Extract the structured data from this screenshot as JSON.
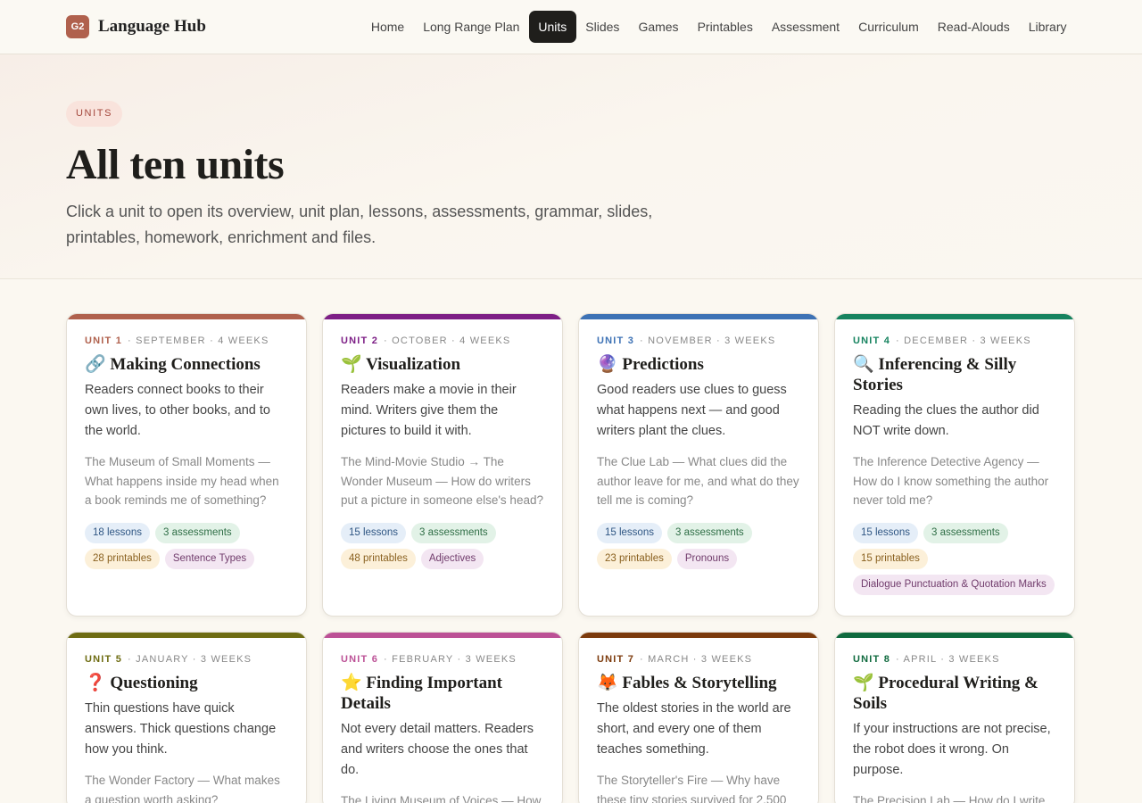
{
  "brand": {
    "logo_text": "G2",
    "name": "Language Hub"
  },
  "nav": [
    {
      "label": "Home",
      "active": false
    },
    {
      "label": "Long Range Plan",
      "active": false
    },
    {
      "label": "Units",
      "active": true
    },
    {
      "label": "Slides",
      "active": false
    },
    {
      "label": "Games",
      "active": false
    },
    {
      "label": "Printables",
      "active": false
    },
    {
      "label": "Assessment",
      "active": false
    },
    {
      "label": "Curriculum",
      "active": false
    },
    {
      "label": "Read-Alouds",
      "active": false
    },
    {
      "label": "Library",
      "active": false
    }
  ],
  "hero": {
    "kicker": "UNITS",
    "title": "All ten units",
    "subtitle": "Click a unit to open its overview, unit plan, lessons, assessments, grammar, slides, printables, homework, enrichment and files."
  },
  "units": [
    {
      "unit": "UNIT 1",
      "meta": "· SEPTEMBER · 4 WEEKS",
      "color": "#b0614d",
      "emoji": "🔗",
      "title": "Making Connections",
      "desc": "Readers connect books to their own lives, to other books, and to the world.",
      "quest": "The Museum of Small Moments — What happens inside my head when a book reminds me of something?",
      "lessons": "18 lessons",
      "assessments": "3 assessments",
      "printables": "28 printables",
      "grammar": "Sentence Types"
    },
    {
      "unit": "UNIT 2",
      "meta": "· OCTOBER · 4 WEEKS",
      "color": "#7d1f86",
      "emoji": "🌱",
      "title": "Visualization",
      "desc": "Readers make a movie in their mind. Writers give them the pictures to build it with.",
      "quest": "The Mind-Movie Studio → The Wonder Museum — How do writers put a picture in someone else's head?",
      "lessons": "15 lessons",
      "assessments": "3 assessments",
      "printables": "48 printables",
      "grammar": "Adjectives"
    },
    {
      "unit": "UNIT 3",
      "meta": "· NOVEMBER · 3 WEEKS",
      "color": "#3d72b5",
      "emoji": "🔮",
      "title": "Predictions",
      "desc": "Good readers use clues to guess what happens next — and good writers plant the clues.",
      "quest": "The Clue Lab — What clues did the author leave for me, and what do they tell me is coming?",
      "lessons": "15 lessons",
      "assessments": "3 assessments",
      "printables": "23 printables",
      "grammar": "Pronouns"
    },
    {
      "unit": "UNIT 4",
      "meta": "· DECEMBER · 3 WEEKS",
      "color": "#16835f",
      "emoji": "🔍",
      "title": "Inferencing & Silly Stories",
      "desc": "Reading the clues the author did NOT write down.",
      "quest": "The Inference Detective Agency — How do I know something the author never told me?",
      "lessons": "15 lessons",
      "assessments": "3 assessments",
      "printables": "15 printables",
      "grammar": "Dialogue Punctuation & Quotation Marks"
    },
    {
      "unit": "UNIT 5",
      "meta": "· JANUARY · 3 WEEKS",
      "color": "#6e6c12",
      "emoji": "❓",
      "title": "Questioning",
      "desc": "Thin questions have quick answers. Thick questions change how you think.",
      "quest": "The Wonder Factory — What makes a question worth asking?"
    },
    {
      "unit": "UNIT 6",
      "meta": "· FEBRUARY · 3 WEEKS",
      "color": "#bc5196",
      "emoji": "⭐",
      "title": "Finding Important Details",
      "desc": "Not every detail matters. Readers and writers choose the ones that do.",
      "quest": "The Living Museum of Voices — How"
    },
    {
      "unit": "UNIT 7",
      "meta": "· MARCH · 3 WEEKS",
      "color": "#7c3a0c",
      "emoji": "🦊",
      "title": "Fables & Storytelling",
      "desc": "The oldest stories in the world are short, and every one of them teaches something.",
      "quest": "The Storyteller's Fire — Why have these tiny stories survived for 2,500"
    },
    {
      "unit": "UNIT 8",
      "meta": "· APRIL · 3 WEEKS",
      "color": "#0f6a3e",
      "emoji": "🌱",
      "title": "Procedural Writing & Soils",
      "desc": "If your instructions are not precise, the robot does it wrong. On purpose.",
      "quest": "The Precision Lab — How do I write"
    }
  ]
}
